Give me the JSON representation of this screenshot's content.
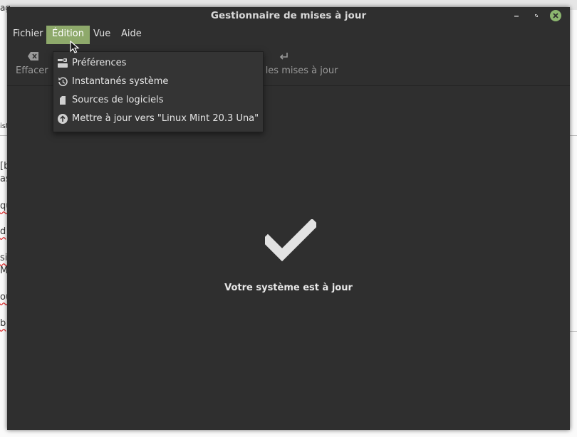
{
  "window": {
    "title": "Gestionnaire de mises à jour"
  },
  "menubar": {
    "items": [
      {
        "label": "Fichier"
      },
      {
        "label": "Édition"
      },
      {
        "label": "Vue"
      },
      {
        "label": "Aide"
      }
    ],
    "active_index": 1
  },
  "toolbar": {
    "clear_label": "Effacer",
    "install_label": "ller les mises à jour"
  },
  "edit_menu": {
    "items": [
      {
        "label": "Préférences",
        "icon": "preferences-icon"
      },
      {
        "label": "Instantanés système",
        "icon": "history-icon"
      },
      {
        "label": "Sources de logiciels",
        "icon": "package-icon"
      },
      {
        "label": "Mettre à jour vers \"Linux Mint 20.3 Una\"",
        "icon": "upgrade-arrow-icon"
      }
    ]
  },
  "status": {
    "message": "Votre système est à jour",
    "icon": "checkmark-icon"
  },
  "background_document": {
    "fragments": [
      "ag",
      "ist",
      "[b",
      "as",
      "qu",
      "d",
      "sic",
      "M",
      "ou",
      "b"
    ]
  },
  "colors": {
    "window_bg": "#2f2f2f",
    "accent": "#8ea96b",
    "close_button": "#8cb66f",
    "text": "#e0e0e0"
  }
}
